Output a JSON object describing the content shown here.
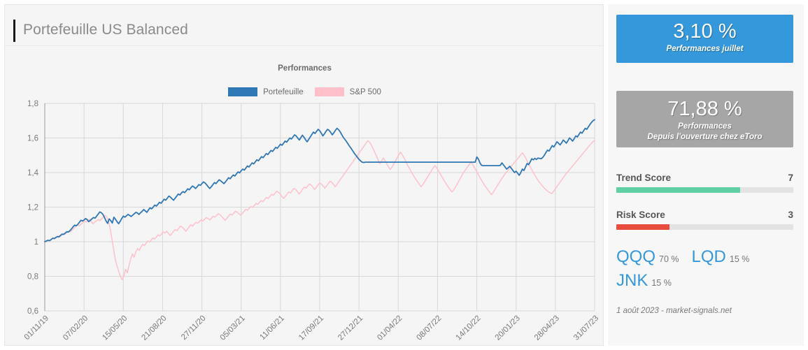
{
  "header": {
    "title": "Portefeuille US Balanced",
    "accent_color": "#1a1a1a"
  },
  "chart_data": {
    "type": "line",
    "title": "Performances",
    "xlabel": "",
    "ylabel": "",
    "grid": true,
    "legend_position": "top-center",
    "ylim": [
      0.6,
      1.8
    ],
    "yticks": [
      "0,6",
      "0,8",
      "1",
      "1,2",
      "1,4",
      "1,6",
      "1,8"
    ],
    "ytick_values": [
      0.6,
      0.8,
      1.0,
      1.2,
      1.4,
      1.6,
      1.8
    ],
    "xticks": [
      "01/11/19",
      "07/02/20",
      "15/05/20",
      "21/08/20",
      "27/11/20",
      "05/03/21",
      "11/06/21",
      "17/09/21",
      "27/12/21",
      "01/04/22",
      "08/07/22",
      "14/10/22",
      "20/01/23",
      "28/04/23",
      "31/07/23"
    ],
    "series": [
      {
        "name": "Portefeuille",
        "color": "#2f77b5",
        "values": [
          1.0,
          1.004,
          1.008,
          1.006,
          1.012,
          1.02,
          1.018,
          1.024,
          1.03,
          1.028,
          1.036,
          1.044,
          1.042,
          1.05,
          1.058,
          1.056,
          1.064,
          1.074,
          1.086,
          1.096,
          1.092,
          1.1,
          1.112,
          1.124,
          1.12,
          1.126,
          1.134,
          1.128,
          1.116,
          1.124,
          1.132,
          1.14,
          1.136,
          1.148,
          1.16,
          1.172,
          1.168,
          1.158,
          1.14,
          1.12,
          1.106,
          1.132,
          1.122,
          1.108,
          1.142,
          1.13,
          1.116,
          1.104,
          1.118,
          1.134,
          1.148,
          1.142,
          1.15,
          1.158,
          1.152,
          1.146,
          1.154,
          1.162,
          1.17,
          1.166,
          1.158,
          1.168,
          1.176,
          1.186,
          1.178,
          1.17,
          1.184,
          1.196,
          1.19,
          1.2,
          1.212,
          1.206,
          1.216,
          1.228,
          1.222,
          1.234,
          1.246,
          1.24,
          1.252,
          1.264,
          1.258,
          1.248,
          1.24,
          1.252,
          1.264,
          1.276,
          1.27,
          1.282,
          1.29,
          1.284,
          1.294,
          1.306,
          1.3,
          1.312,
          1.322,
          1.316,
          1.308,
          1.318,
          1.33,
          1.326,
          1.336,
          1.346,
          1.34,
          1.33,
          1.318,
          1.308,
          1.318,
          1.33,
          1.342,
          1.336,
          1.348,
          1.358,
          1.352,
          1.344,
          1.336,
          1.346,
          1.358,
          1.37,
          1.364,
          1.376,
          1.386,
          1.38,
          1.392,
          1.404,
          1.398,
          1.41,
          1.42,
          1.414,
          1.426,
          1.438,
          1.432,
          1.444,
          1.456,
          1.45,
          1.462,
          1.474,
          1.468,
          1.48,
          1.492,
          1.486,
          1.498,
          1.51,
          1.504,
          1.516,
          1.528,
          1.522,
          1.534,
          1.546,
          1.54,
          1.552,
          1.564,
          1.558,
          1.57,
          1.582,
          1.576,
          1.588,
          1.6,
          1.594,
          1.606,
          1.618,
          1.612,
          1.6,
          1.588,
          1.602,
          1.616,
          1.604,
          1.59,
          1.578,
          1.592,
          1.606,
          1.62,
          1.634,
          1.626,
          1.638,
          1.65,
          1.642,
          1.628,
          1.612,
          1.624,
          1.638,
          1.65,
          1.644,
          1.632,
          1.618,
          1.63,
          1.644,
          1.656,
          1.648,
          1.636,
          1.62,
          1.604,
          1.592,
          1.58,
          1.566,
          1.552,
          1.54,
          1.526,
          1.512,
          1.5,
          1.488,
          1.476,
          1.468,
          1.46,
          1.458,
          1.46,
          1.46,
          1.46,
          1.46,
          1.46,
          1.46,
          1.46,
          1.46,
          1.46,
          1.46,
          1.46,
          1.46,
          1.46,
          1.46,
          1.46,
          1.46,
          1.46,
          1.46,
          1.46,
          1.46,
          1.46,
          1.46,
          1.46,
          1.46,
          1.46,
          1.46,
          1.46,
          1.46,
          1.46,
          1.46,
          1.46,
          1.46,
          1.46,
          1.46,
          1.46,
          1.46,
          1.46,
          1.46,
          1.46,
          1.46,
          1.46,
          1.46,
          1.46,
          1.46,
          1.46,
          1.46,
          1.46,
          1.46,
          1.46,
          1.46,
          1.46,
          1.46,
          1.46,
          1.46,
          1.46,
          1.46,
          1.46,
          1.46,
          1.46,
          1.46,
          1.46,
          1.46,
          1.46,
          1.46,
          1.46,
          1.46,
          1.46,
          1.46,
          1.46,
          1.46,
          1.46,
          1.49,
          1.478,
          1.456,
          1.442,
          1.44,
          1.44,
          1.44,
          1.44,
          1.44,
          1.44,
          1.44,
          1.44,
          1.44,
          1.44,
          1.44,
          1.442,
          1.456,
          1.444,
          1.432,
          1.42,
          1.428,
          1.436,
          1.424,
          1.412,
          1.4,
          1.408,
          1.396,
          1.384,
          1.4,
          1.42,
          1.412,
          1.432,
          1.452,
          1.446,
          1.462,
          1.48,
          1.474,
          1.482,
          1.476,
          1.484,
          1.482,
          1.48,
          1.488,
          1.5,
          1.516,
          1.53,
          1.524,
          1.54,
          1.556,
          1.548,
          1.562,
          1.578,
          1.57,
          1.56,
          1.572,
          1.588,
          1.58,
          1.57,
          1.584,
          1.6,
          1.592,
          1.582,
          1.596,
          1.612,
          1.606,
          1.62,
          1.634,
          1.628,
          1.642,
          1.656,
          1.65,
          1.664,
          1.678,
          1.69,
          1.7,
          1.706
        ],
        "start_value": 1.0,
        "end_value": 1.706,
        "max_value": 1.706,
        "min_value": 1.0
      },
      {
        "name": "S&P 500",
        "color": "#ffc0cb",
        "values": [
          1.0,
          1.004,
          1.01,
          1.006,
          1.014,
          1.022,
          1.018,
          1.026,
          1.034,
          1.03,
          1.04,
          1.048,
          1.044,
          1.054,
          1.062,
          1.058,
          1.068,
          1.078,
          1.088,
          1.098,
          1.092,
          1.1,
          1.11,
          1.12,
          1.114,
          1.12,
          1.128,
          1.118,
          1.104,
          1.112,
          1.12,
          1.128,
          1.122,
          1.132,
          1.142,
          1.152,
          1.144,
          1.12,
          1.08,
          1.02,
          0.96,
          0.9,
          0.86,
          0.83,
          0.8,
          0.78,
          0.8,
          0.84,
          0.82,
          0.86,
          0.9,
          0.93,
          0.91,
          0.94,
          0.96,
          0.95,
          0.97,
          0.985,
          0.978,
          0.992,
          1.005,
          0.998,
          1.01,
          1.022,
          1.016,
          1.028,
          1.04,
          1.034,
          1.045,
          1.056,
          1.05,
          1.06,
          1.048,
          1.036,
          1.048,
          1.062,
          1.07,
          1.064,
          1.078,
          1.09,
          1.084,
          1.074,
          1.06,
          1.072,
          1.086,
          1.098,
          1.09,
          1.102,
          1.112,
          1.106,
          1.116,
          1.126,
          1.12,
          1.13,
          1.14,
          1.134,
          1.126,
          1.136,
          1.148,
          1.142,
          1.152,
          1.162,
          1.156,
          1.146,
          1.134,
          1.124,
          1.136,
          1.148,
          1.16,
          1.154,
          1.166,
          1.176,
          1.17,
          1.162,
          1.154,
          1.164,
          1.176,
          1.188,
          1.182,
          1.194,
          1.204,
          1.198,
          1.21,
          1.222,
          1.216,
          1.228,
          1.238,
          1.232,
          1.244,
          1.256,
          1.25,
          1.262,
          1.274,
          1.268,
          1.28,
          1.292,
          1.286,
          1.276,
          1.262,
          1.25,
          1.262,
          1.276,
          1.288,
          1.282,
          1.296,
          1.308,
          1.302,
          1.29,
          1.276,
          1.288,
          1.302,
          1.316,
          1.31,
          1.322,
          1.334,
          1.328,
          1.316,
          1.302,
          1.314,
          1.328,
          1.34,
          1.334,
          1.322,
          1.31,
          1.322,
          1.336,
          1.35,
          1.344,
          1.332,
          1.318,
          1.33,
          1.346,
          1.36,
          1.374,
          1.388,
          1.402,
          1.416,
          1.43,
          1.444,
          1.458,
          1.472,
          1.486,
          1.5,
          1.514,
          1.528,
          1.542,
          1.556,
          1.57,
          1.584,
          1.576,
          1.56,
          1.54,
          1.518,
          1.496,
          1.474,
          1.452,
          1.468,
          1.484,
          1.47,
          1.452,
          1.434,
          1.418,
          1.43,
          1.448,
          1.466,
          1.484,
          1.502,
          1.518,
          1.504,
          1.486,
          1.466,
          1.446,
          1.428,
          1.41,
          1.392,
          1.376,
          1.36,
          1.346,
          1.332,
          1.318,
          1.33,
          1.346,
          1.362,
          1.378,
          1.394,
          1.41,
          1.426,
          1.44,
          1.428,
          1.412,
          1.396,
          1.378,
          1.36,
          1.344,
          1.328,
          1.314,
          1.3,
          1.288,
          1.3,
          1.316,
          1.334,
          1.352,
          1.37,
          1.388,
          1.404,
          1.418,
          1.432,
          1.446,
          1.46,
          1.448,
          1.43,
          1.412,
          1.394,
          1.376,
          1.358,
          1.342,
          1.326,
          1.312,
          1.298,
          1.284,
          1.272,
          1.286,
          1.302,
          1.318,
          1.334,
          1.35,
          1.366,
          1.38,
          1.394,
          1.406,
          1.418,
          1.43,
          1.442,
          1.454,
          1.466,
          1.478,
          1.49,
          1.502,
          1.514,
          1.5,
          1.482,
          1.462,
          1.442,
          1.424,
          1.406,
          1.388,
          1.372,
          1.356,
          1.342,
          1.33,
          1.318,
          1.308,
          1.298,
          1.29,
          1.284,
          1.278,
          1.29,
          1.304,
          1.318,
          1.332,
          1.346,
          1.36,
          1.374,
          1.388,
          1.4,
          1.412,
          1.424,
          1.436,
          1.448,
          1.46,
          1.472,
          1.484,
          1.496,
          1.508,
          1.52,
          1.532,
          1.544,
          1.556,
          1.568,
          1.578,
          1.586
        ],
        "start_value": 1.0,
        "end_value": 1.586,
        "max_value": 1.586,
        "min_value": 0.78
      }
    ]
  },
  "legend": [
    {
      "label": "Portefeuille",
      "color": "#2f77b5"
    },
    {
      "label": "S&P 500",
      "color": "#ffc0cb"
    }
  ],
  "stats": [
    {
      "value": "3,10 %",
      "label": "Performances juillet",
      "label_line2": "",
      "bg": "#3498db"
    },
    {
      "value": "71,88 %",
      "label": "Performances",
      "label_line2": "Depuis l'ouverture chez eToro",
      "bg": "#a6a6a6"
    }
  ],
  "scores": [
    {
      "name": "Trend Score",
      "value": "7",
      "percent": 70,
      "color": "#5fd0a4"
    },
    {
      "name": "Risk Score",
      "value": "3",
      "percent": 30,
      "color": "#e74c3c"
    }
  ],
  "holdings": [
    {
      "ticker": "QQQ",
      "weight": "70 %"
    },
    {
      "ticker": "LQD",
      "weight": "15 %"
    },
    {
      "ticker": "JNK",
      "weight": "15 %"
    }
  ],
  "footer": {
    "note": "1 août 2023 - market-signals.net"
  }
}
